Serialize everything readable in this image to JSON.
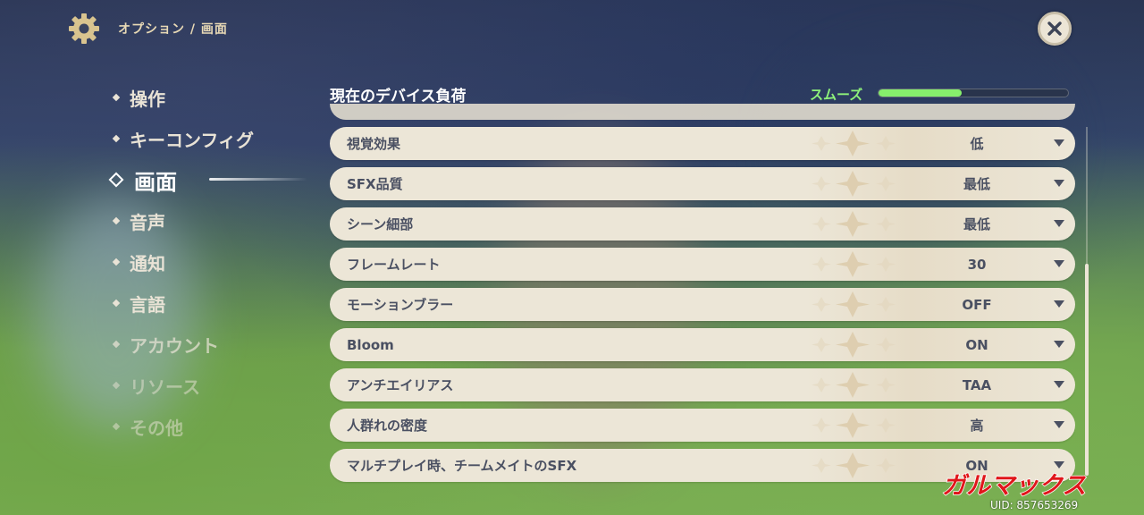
{
  "header": {
    "breadcrumb": "オプション / 画面",
    "settings_icon": "gear-icon",
    "close_icon": "close-icon"
  },
  "sidebar": {
    "items": [
      {
        "label": "操作",
        "active": false
      },
      {
        "label": "キーコンフィグ",
        "active": false
      },
      {
        "label": "画面",
        "active": true
      },
      {
        "label": "音声",
        "active": false
      },
      {
        "label": "通知",
        "active": false
      },
      {
        "label": "言語",
        "active": false
      },
      {
        "label": "アカウント",
        "active": false
      },
      {
        "label": "リソース",
        "active": false
      },
      {
        "label": "その他",
        "active": false
      }
    ]
  },
  "device_load": {
    "title": "現在のデバイス負荷",
    "status": "スムーズ",
    "level": 0.44,
    "bar_color": "#86ef6c"
  },
  "settings": [
    {
      "label": "視覚効果",
      "value": "低"
    },
    {
      "label": "SFX品質",
      "value": "最低"
    },
    {
      "label": "シーン細部",
      "value": "最低"
    },
    {
      "label": "フレームレート",
      "value": "30"
    },
    {
      "label": "モーションブラー",
      "value": "OFF"
    },
    {
      "label": "Bloom",
      "value": "ON"
    },
    {
      "label": "アンチエイリアス",
      "value": "TAA"
    },
    {
      "label": "人群れの密度",
      "value": "高"
    },
    {
      "label": "マルチプレイ時、チームメイトのSFX",
      "value": "ON"
    }
  ],
  "watermark": {
    "logo_text": "ガルマックス",
    "uid": "UID: 857653269"
  },
  "colors": {
    "row_bg": "#ece6d7",
    "row_text": "#4a5062",
    "accent_green": "#8ef27a",
    "breadcrumb_gold": "#e8d9b5",
    "watermark_red": "#e0161b"
  }
}
